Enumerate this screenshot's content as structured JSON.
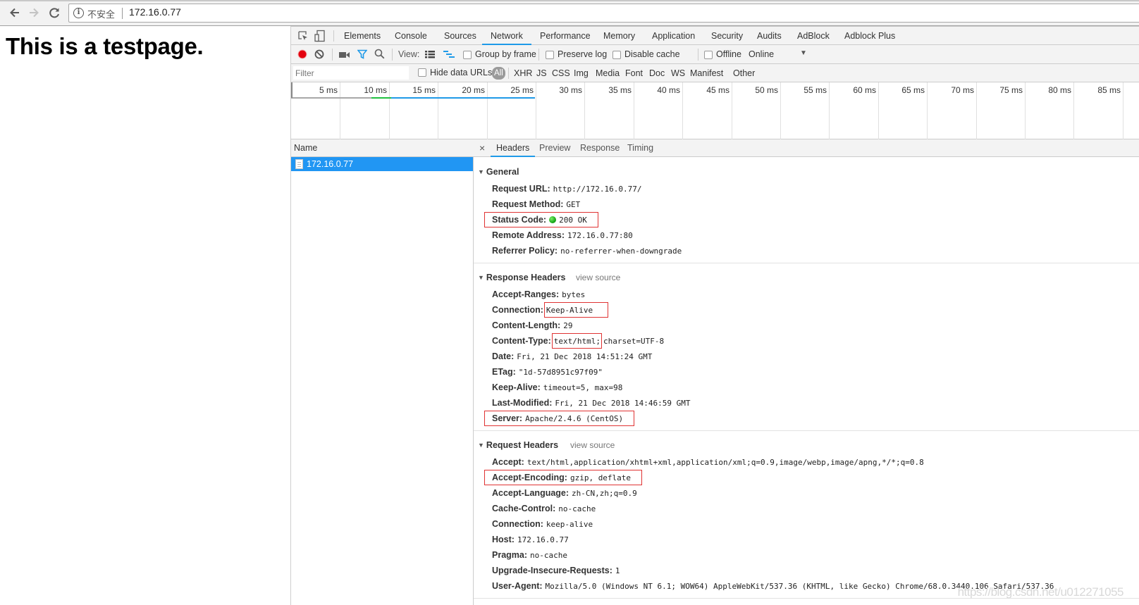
{
  "browser": {
    "back_icon": "arrow-left-icon",
    "forward_icon": "arrow-right-icon",
    "reload_icon": "reload-icon",
    "security_icon": "info-circle-icon",
    "security_label": "不安全",
    "url": "172.16.0.77"
  },
  "page": {
    "heading": "This is a testpage."
  },
  "devtools": {
    "panel_tabs": [
      {
        "label": "Elements"
      },
      {
        "label": "Console"
      },
      {
        "label": "Sources"
      },
      {
        "label": "Network",
        "active": true
      },
      {
        "label": "Performance"
      },
      {
        "label": "Memory"
      },
      {
        "label": "Application"
      },
      {
        "label": "Security"
      },
      {
        "label": "Audits"
      },
      {
        "label": "AdBlock"
      },
      {
        "label": "Adblock Plus"
      }
    ],
    "toolbar": {
      "record_color": "#e3000e",
      "view_label": "View:",
      "group_by_frame": {
        "label": "Group by frame",
        "checked": false
      },
      "preserve_log": {
        "label": "Preserve log",
        "checked": false
      },
      "disable_cache": {
        "label": "Disable cache",
        "checked": false
      },
      "offline": {
        "label": "Offline",
        "checked": false
      },
      "throttling": "Online"
    },
    "filterbar": {
      "filter_placeholder": "Filter",
      "hide_data_urls": {
        "label": "Hide data URLs",
        "checked": false
      },
      "types": [
        "All",
        "XHR",
        "JS",
        "CSS",
        "Img",
        "Media",
        "Font",
        "Doc",
        "WS",
        "Manifest",
        "Other"
      ],
      "active_type": "All"
    },
    "timeline": {
      "ticks": [
        "5 ms",
        "10 ms",
        "15 ms",
        "20 ms",
        "25 ms",
        "30 ms",
        "35 ms",
        "40 ms",
        "45 ms",
        "50 ms",
        "55 ms",
        "60 ms",
        "65 ms",
        "70 ms",
        "75 ms",
        "80 ms",
        "85 ms"
      ],
      "request_bar": {
        "waiting_start_ms": 0,
        "waiting_end_ms": 8.2,
        "connect_start_ms": 8.2,
        "connect_end_ms": 10.2,
        "download_start_ms": 10.2,
        "download_end_ms": 24.9,
        "colors": {
          "waiting": "#a8a8a8",
          "connect": "#20c040",
          "download": "#1f9ae8"
        }
      }
    },
    "requests": {
      "column_header": "Name",
      "items": [
        {
          "name": "172.16.0.77",
          "selected": true
        }
      ]
    },
    "details": {
      "close_label": "×",
      "tabs": [
        {
          "label": "Headers",
          "active": true
        },
        {
          "label": "Preview"
        },
        {
          "label": "Response"
        },
        {
          "label": "Timing"
        }
      ],
      "general": {
        "title": "General",
        "rows": [
          {
            "name": "Request URL:",
            "value": "http://172.16.0.77/"
          },
          {
            "name": "Request Method:",
            "value": "GET"
          },
          {
            "name": "Status Code:",
            "value": "200 OK",
            "status_color": "#1aa818",
            "highlighted": true
          },
          {
            "name": "Remote Address:",
            "value": "172.16.0.77:80"
          },
          {
            "name": "Referrer Policy:",
            "value": "no-referrer-when-downgrade"
          }
        ]
      },
      "response_headers": {
        "title": "Response Headers",
        "view_source": "view source",
        "rows": [
          {
            "name": "Accept-Ranges:",
            "value": "bytes"
          },
          {
            "name": "Connection:",
            "value": "Keep-Alive",
            "highlighted": true
          },
          {
            "name": "Content-Length:",
            "value": "29"
          },
          {
            "name": "Content-Type:",
            "value": "text/html;",
            "value_extra": "charset=UTF-8",
            "highlighted": true
          },
          {
            "name": "Date:",
            "value": "Fri, 21 Dec 2018 14:51:24 GMT"
          },
          {
            "name": "ETag:",
            "value": "\"1d-57d8951c97f09\""
          },
          {
            "name": "Keep-Alive:",
            "value": "timeout=5, max=98"
          },
          {
            "name": "Last-Modified:",
            "value": "Fri, 21 Dec 2018 14:46:59 GMT"
          },
          {
            "name": "Server:",
            "value": "Apache/2.4.6 (CentOS)",
            "highlighted": true
          }
        ]
      },
      "request_headers": {
        "title": "Request Headers",
        "view_source": "view source",
        "rows": [
          {
            "name": "Accept:",
            "value": "text/html,application/xhtml+xml,application/xml;q=0.9,image/webp,image/apng,*/*;q=0.8"
          },
          {
            "name": "Accept-Encoding:",
            "value": "gzip, deflate",
            "highlighted": true
          },
          {
            "name": "Accept-Language:",
            "value": "zh-CN,zh;q=0.9"
          },
          {
            "name": "Cache-Control:",
            "value": "no-cache"
          },
          {
            "name": "Connection:",
            "value": "keep-alive"
          },
          {
            "name": "Host:",
            "value": "172.16.0.77"
          },
          {
            "name": "Pragma:",
            "value": "no-cache"
          },
          {
            "name": "Upgrade-Insecure-Requests:",
            "value": "1"
          },
          {
            "name": "User-Agent:",
            "value": "Mozilla/5.0 (Windows NT 6.1; WOW64) AppleWebKit/537.36 (KHTML, like Gecko) Chrome/68.0.3440.106 Safari/537.36"
          }
        ]
      },
      "highlight_color": "#e03333"
    }
  },
  "watermark": "https://blog.csdn.net/u012271055"
}
